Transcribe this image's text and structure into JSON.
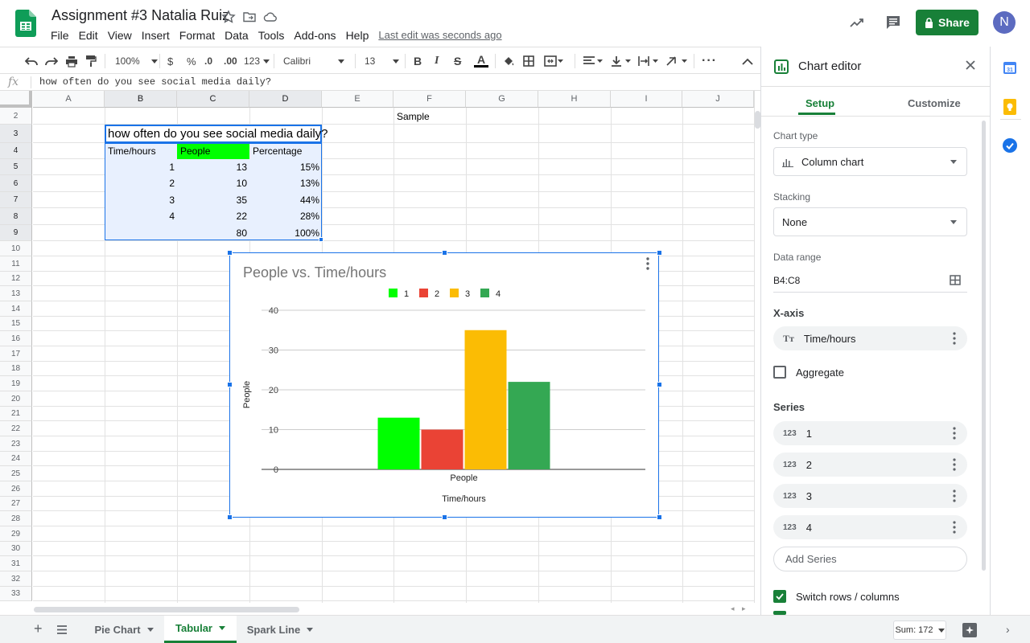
{
  "app": {
    "title": "Assignment #3 Natalia Ruiz",
    "last_edit": "Last edit was seconds ago",
    "share_label": "Share",
    "avatar_initial": "N"
  },
  "menu": [
    "File",
    "Edit",
    "View",
    "Insert",
    "Format",
    "Data",
    "Tools",
    "Add-ons",
    "Help"
  ],
  "toolbar": {
    "zoom": "100%",
    "currency": "$",
    "percent": "%",
    "dec_less": ".0",
    "dec_more": ".00",
    "format_more": "123",
    "font": "Calibri",
    "font_size": "13"
  },
  "formula": {
    "fx": "fx",
    "content": "how often do you see social media daily?"
  },
  "columns": [
    "A",
    "B",
    "C",
    "D",
    "E",
    "F",
    "G",
    "H",
    "I",
    "J"
  ],
  "rows": [
    "2",
    "3",
    "4",
    "5",
    "6",
    "7",
    "8",
    "9",
    "10",
    "11",
    "12",
    "13",
    "14",
    "15",
    "16",
    "17",
    "18",
    "19",
    "20",
    "21",
    "22",
    "23",
    "24",
    "25",
    "26",
    "27",
    "28",
    "29",
    "30",
    "31",
    "32",
    "33"
  ],
  "cells": {
    "sample": "Sample",
    "table_title": "how often do you see social media daily?",
    "headers": [
      "Time/hours",
      "People",
      "Percentage"
    ],
    "data": [
      [
        "1",
        "13",
        "15%"
      ],
      [
        "2",
        "10",
        "13%"
      ],
      [
        "3",
        "35",
        "44%"
      ],
      [
        "4",
        "22",
        "28%"
      ],
      [
        "",
        "80",
        "100%"
      ]
    ]
  },
  "chart_data": {
    "type": "bar",
    "title": "People vs. Time/hours",
    "categories": [
      "People"
    ],
    "series": [
      {
        "name": "1",
        "values": [
          13
        ],
        "color": "#00ff00"
      },
      {
        "name": "2",
        "values": [
          10
        ],
        "color": "#ea4335"
      },
      {
        "name": "3",
        "values": [
          35
        ],
        "color": "#fbbc04"
      },
      {
        "name": "4",
        "values": [
          22
        ],
        "color": "#34a853"
      }
    ],
    "xlabel": "Time/hours",
    "ylabel": "People",
    "ylim": [
      0,
      40
    ],
    "yticks": [
      "0",
      "10",
      "20",
      "30",
      "40"
    ],
    "legend": "top",
    "grid": true
  },
  "editor": {
    "title": "Chart editor",
    "tabs": [
      "Setup",
      "Customize"
    ],
    "chart_type_label": "Chart type",
    "chart_type": "Column chart",
    "stacking_label": "Stacking",
    "stacking": "None",
    "data_range_label": "Data range",
    "data_range": "B4:C8",
    "xaxis_label": "X-axis",
    "xaxis_value": "Time/hours",
    "aggregate": "Aggregate",
    "series_label": "Series",
    "series": [
      "1",
      "2",
      "3",
      "4"
    ],
    "series_icon": "123",
    "add_series": "Add Series",
    "switch_rows": "Switch rows / columns"
  },
  "sheets": {
    "tabs": [
      "Pie Chart",
      "Tabular",
      "Spark Line"
    ],
    "active": "Tabular",
    "sum": "Sum: 172"
  },
  "colors": {
    "brand_green": "#188038",
    "selection_blue": "#1a73e8",
    "header_green": "#00ff00",
    "range_fill": "#e8f0fe"
  }
}
